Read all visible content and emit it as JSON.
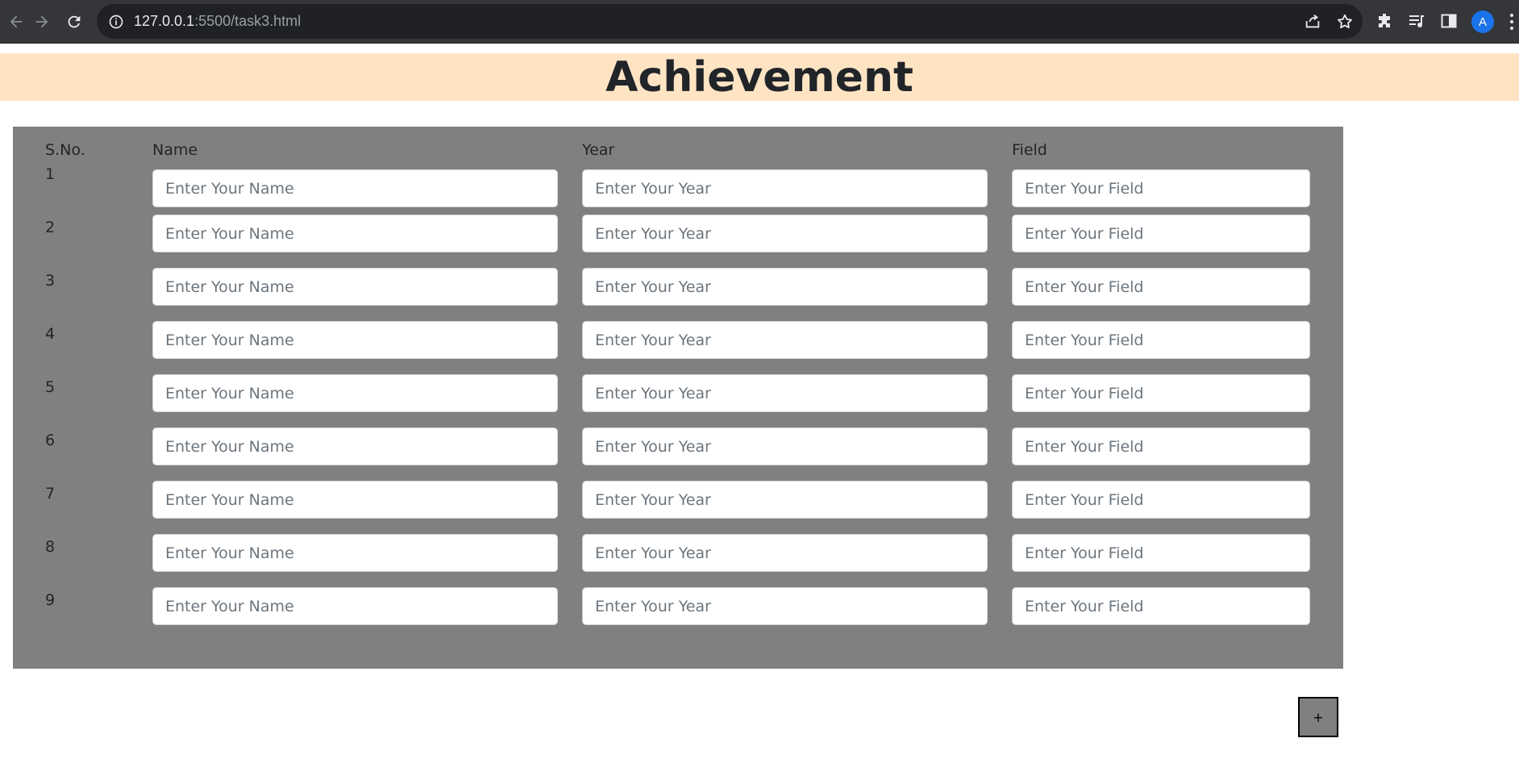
{
  "browser": {
    "url_host": "127.0.0.1",
    "url_rest": ":5500/task3.html",
    "profile_initial": "A"
  },
  "page": {
    "title": "Achievement",
    "columns": [
      "S.No.",
      "Name",
      "Year",
      "Field"
    ],
    "placeholders": {
      "name": "Enter Your Name",
      "year": "Enter Your Year",
      "field": "Enter Your Field"
    },
    "rows": [
      {
        "sno": "1",
        "name": "",
        "year": "",
        "field": ""
      },
      {
        "sno": "2",
        "name": "",
        "year": "",
        "field": ""
      },
      {
        "sno": "3",
        "name": "",
        "year": "",
        "field": ""
      },
      {
        "sno": "4",
        "name": "",
        "year": "",
        "field": ""
      },
      {
        "sno": "5",
        "name": "",
        "year": "",
        "field": ""
      },
      {
        "sno": "6",
        "name": "",
        "year": "",
        "field": ""
      },
      {
        "sno": "7",
        "name": "",
        "year": "",
        "field": ""
      },
      {
        "sno": "8",
        "name": "",
        "year": "",
        "field": ""
      },
      {
        "sno": "9",
        "name": "",
        "year": "",
        "field": ""
      }
    ],
    "add_button_label": "+"
  },
  "colors": {
    "heading_band": "#ffe4c4",
    "panel": "#808080",
    "browser_chrome": "#35363a"
  }
}
